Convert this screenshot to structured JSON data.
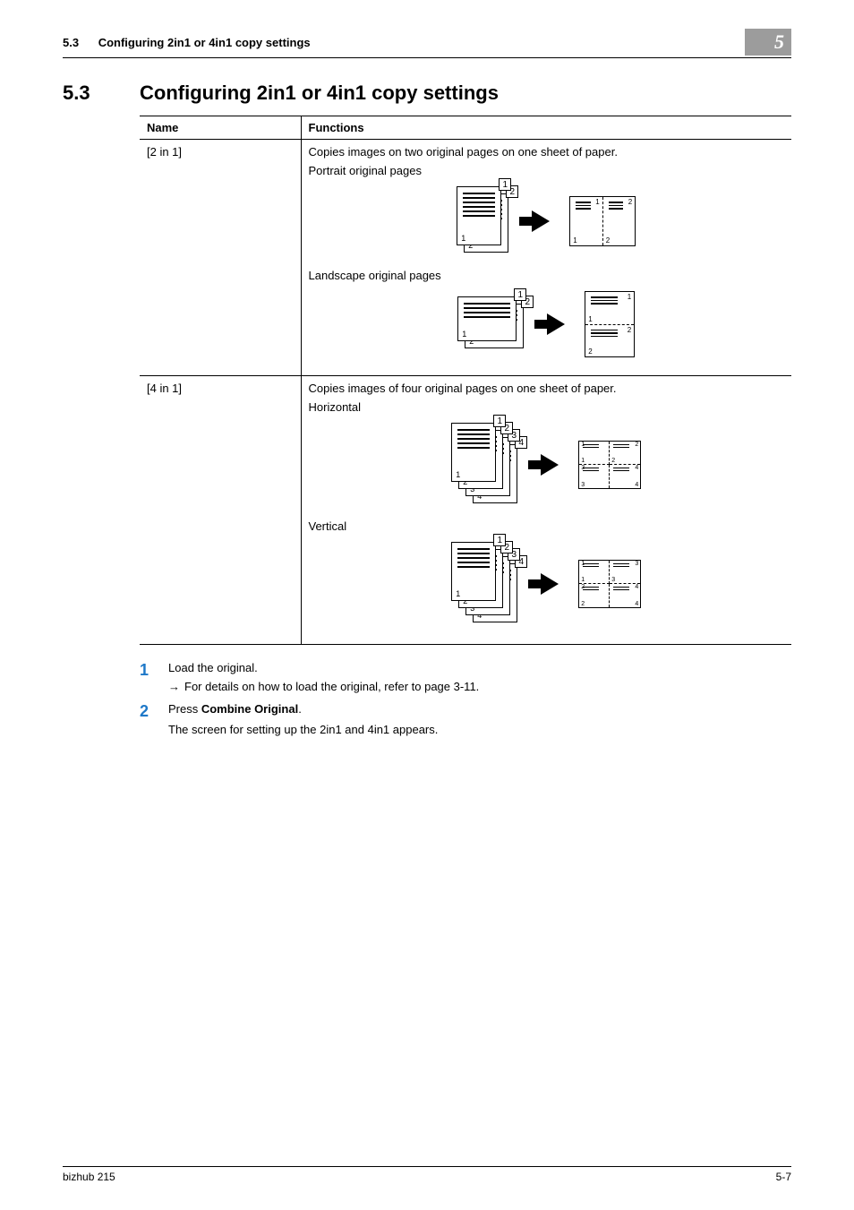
{
  "header": {
    "section_number": "5.3",
    "section_title_short": "Configuring 2in1 or 4in1 copy settings",
    "chapter_number": "5"
  },
  "section": {
    "number": "5.3",
    "title": "Configuring 2in1 or 4in1 copy settings"
  },
  "table": {
    "headers": {
      "name": "Name",
      "functions": "Functions"
    },
    "rows": [
      {
        "name": "[2 in 1]",
        "desc": "Copies images on two original pages on one sheet of paper.",
        "label1": "Portrait original pages",
        "label2": "Landscape original pages"
      },
      {
        "name": "[4 in 1]",
        "desc": "Copies images of four original pages on one sheet of paper.",
        "label1": "Horizontal",
        "label2": "Vertical"
      }
    ]
  },
  "steps": {
    "s1": {
      "num": "1",
      "text": "Load the original.",
      "sub_arrow": "→",
      "sub_text": "For details on how to load the original, refer to page 3-11."
    },
    "s2": {
      "num": "2",
      "text_prefix": "Press ",
      "text_bold": "Combine Original",
      "text_suffix": ".",
      "after": "The screen for setting up the 2in1 and 4in1 appears."
    }
  },
  "footer": {
    "left": "bizhub 215",
    "right": "5-7"
  }
}
